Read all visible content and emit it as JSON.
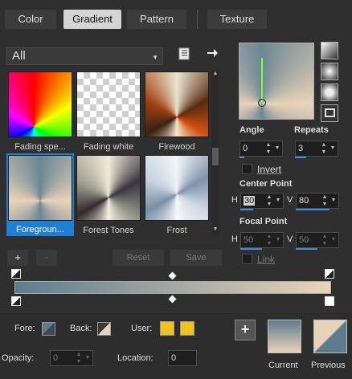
{
  "tabs": [
    "Color",
    "Gradient",
    "Pattern",
    "Texture"
  ],
  "category_select": "All",
  "gradients": [
    {
      "label": "Fading spe..."
    },
    {
      "label": "Fading white"
    },
    {
      "label": "Firewood"
    },
    {
      "label": "Foregroun..."
    },
    {
      "label": "Forest Tones"
    },
    {
      "label": "Frost"
    }
  ],
  "toolbar": {
    "add": "+",
    "remove": "-",
    "reset": "Reset",
    "save": "Save"
  },
  "angle": {
    "label": "Angle",
    "value": "0"
  },
  "repeats": {
    "label": "Repeats",
    "value": "3"
  },
  "invert": "Invert",
  "center_point": {
    "label": "Center Point",
    "h_label": "H",
    "h": "30",
    "v_label": "V",
    "v": "80"
  },
  "focal_point": {
    "label": "Focal Point",
    "h_label": "H",
    "h": "50",
    "v_label": "V",
    "v": "50"
  },
  "link": "Link",
  "bottom": {
    "fore_label": "Fore:",
    "back_label": "Back:",
    "user_label": "User:",
    "opacity_label": "Opacity:",
    "opacity": "0",
    "location_label": "Location:",
    "location": "0",
    "add_button": "+",
    "current": "Current",
    "previous": "Previous"
  },
  "colors": {
    "accent": "#1e7fd4",
    "gradient_start": "#5c7c8e",
    "gradient_end": "#e9d3b8",
    "user_color": "#f1c21b"
  },
  "icons": [
    "book-icon",
    "arrow-right-icon",
    "linear-style-icon",
    "radial-style-icon",
    "rectangular-style-icon",
    "sunburst-style-icon",
    "stop-marker-icon",
    "midpoint-diamond-icon",
    "fill-swatch-icon"
  ]
}
